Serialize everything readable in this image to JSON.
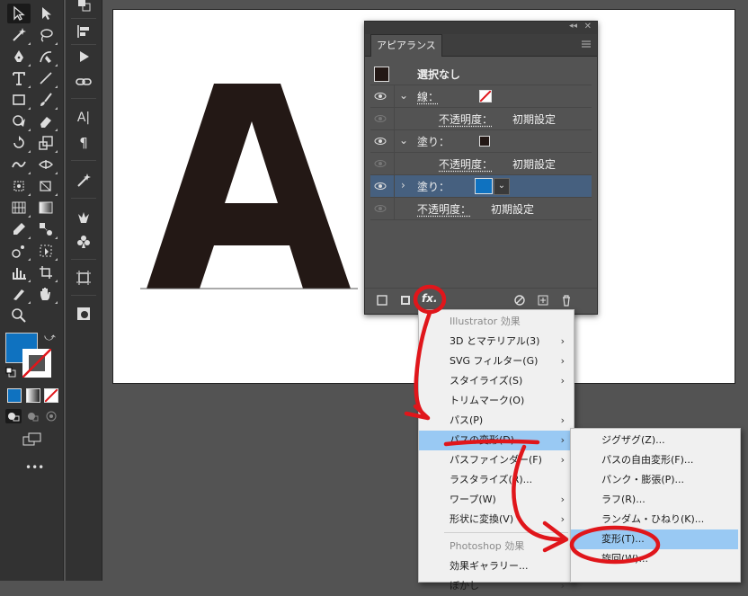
{
  "toolbar": {
    "tools_col1": [
      "selection-tool",
      "pen-tool",
      "type-tool",
      "rectangle-tool",
      "shaper-tool",
      "rotate-tool",
      "warp-tool",
      "free-transform-tool",
      "mesh-tool",
      "eyedropper-tool",
      "symbol-sprayer-tool",
      "column-graph-tool",
      "knife-tool",
      "zoom-tool"
    ],
    "tools_col2": [
      "direct-selection-tool",
      "lasso-tool",
      "curvature-tool",
      "line-segment-tool",
      "paintbrush-tool",
      "eraser-tool",
      "scale-tool",
      "shape-builder-tool",
      "perspective-grid-tool",
      "gradient-tool",
      "blend-tool",
      "artboard-tool",
      "hand-tool"
    ],
    "fill_color": "#0f72c0",
    "more_label": "•••"
  },
  "toolbar2": {
    "tools": [
      "transform-panel",
      "align-panel",
      "actions-panel",
      "links-panel",
      "character-panel",
      "paragraph-panel",
      "magic-wand-panel",
      "puppet-warp-panel",
      "symbols-panel",
      "artboards-panel",
      "image-trace-panel"
    ],
    "char_label": "A|",
    "para_label": "¶"
  },
  "artwork": {
    "letter_color": "#231815"
  },
  "appearance": {
    "panel_title": "アピアランス",
    "collapse_label": "◂◂",
    "close_label": "✕",
    "rows": [
      {
        "kind": "header",
        "swatch": "#231815",
        "label": "選択なし"
      },
      {
        "kind": "stroke",
        "label": "線：",
        "expanded": true
      },
      {
        "kind": "opacity",
        "label": "不透明度：",
        "value": "初期設定"
      },
      {
        "kind": "fill",
        "label": "塗り：",
        "swatch": "#231815",
        "expanded": true
      },
      {
        "kind": "opacity",
        "label": "不透明度：",
        "value": "初期設定"
      },
      {
        "kind": "fill",
        "label": "塗り：",
        "swatch": "#0f72c0",
        "expanded": false,
        "selected": true
      },
      {
        "kind": "opacity",
        "label": "不透明度：",
        "value": "初期設定"
      }
    ],
    "fx_label": "fx."
  },
  "effect_menu": {
    "items": [
      {
        "label": "Illustrator 効果",
        "type": "header"
      },
      {
        "label": "3D とマテリアル(3)",
        "sub": true
      },
      {
        "label": "SVG フィルター(G)",
        "sub": true
      },
      {
        "label": "スタイライズ(S)",
        "sub": true
      },
      {
        "label": "トリムマーク(O)",
        "sub": false
      },
      {
        "label": "パス(P)",
        "sub": true
      },
      {
        "label": "パスの変形(D)",
        "sub": true,
        "highlight": true
      },
      {
        "label": "パスファインダー(F)",
        "sub": true
      },
      {
        "label": "ラスタライズ(R)...",
        "sub": false
      },
      {
        "label": "ワープ(W)",
        "sub": true
      },
      {
        "label": "形状に変換(V)",
        "sub": true
      },
      {
        "label": "Photoshop 効果",
        "type": "header"
      },
      {
        "label": "効果ギャラリー...",
        "sub": false
      },
      {
        "label": "ぼかし",
        "sub": true
      }
    ],
    "arrow": "›"
  },
  "distort_submenu": {
    "items": [
      {
        "label": "ジグザグ(Z)..."
      },
      {
        "label": "パスの自由変形(F)..."
      },
      {
        "label": "パンク・膨張(P)..."
      },
      {
        "label": "ラフ(R)..."
      },
      {
        "label": "ランダム・ひねり(K)..."
      },
      {
        "label": "変形(T)...",
        "highlight": true
      },
      {
        "label": "旋回(W)..."
      }
    ]
  },
  "annotation": {
    "color": "#e0161b"
  }
}
